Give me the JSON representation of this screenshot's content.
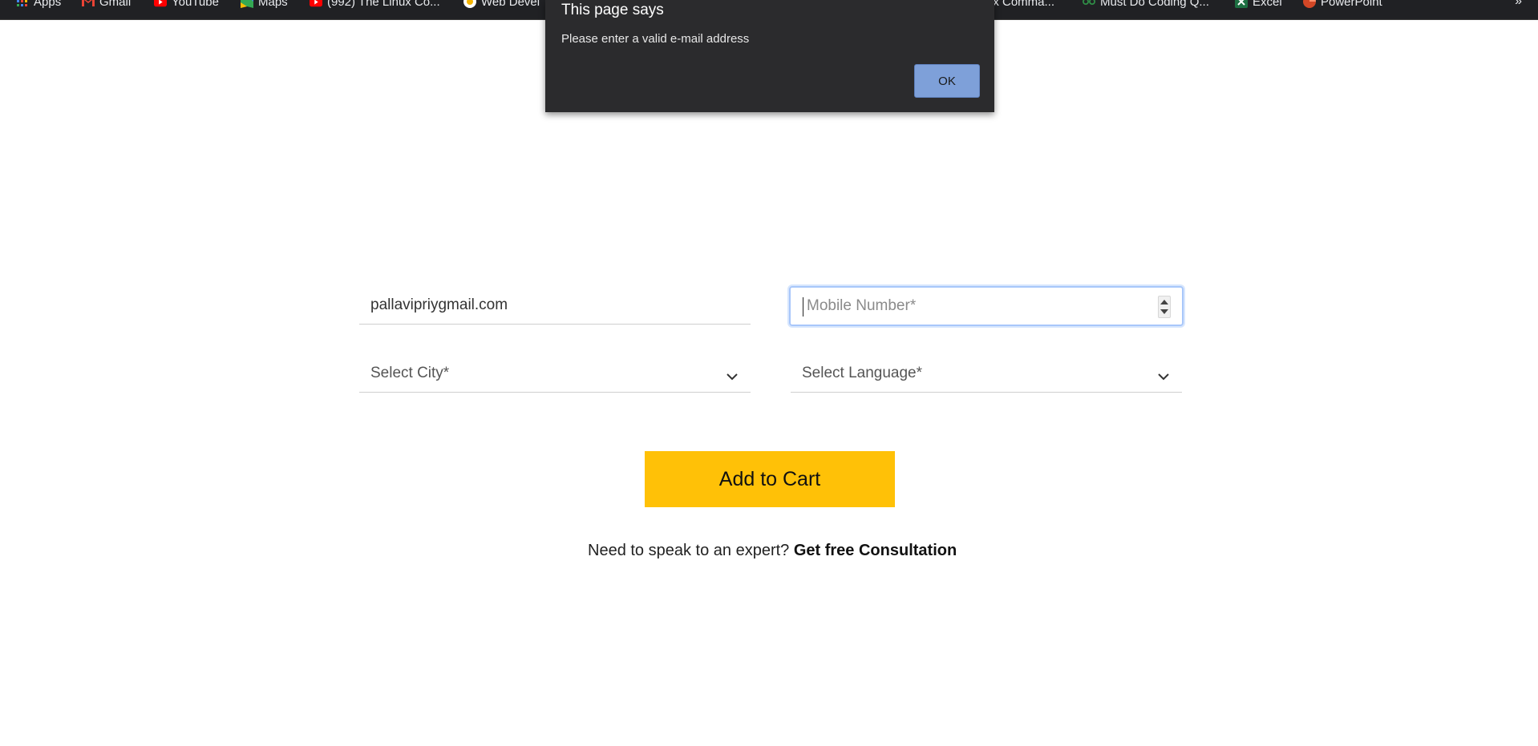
{
  "bookmarks": [
    {
      "label": "Apps",
      "icon": "apps-grid-icon"
    },
    {
      "label": "Gmail",
      "icon": "gmail-icon"
    },
    {
      "label": "YouTube",
      "icon": "youtube-icon"
    },
    {
      "label": "Maps",
      "icon": "maps-icon"
    },
    {
      "label": "(992) The Linux Co...",
      "icon": "youtube-icon"
    },
    {
      "label": "Web Devel",
      "icon": "web-icon"
    },
    {
      "label": "ux Comma...",
      "icon": ""
    },
    {
      "label": "Must Do Coding Q...",
      "icon": "geeks-icon"
    },
    {
      "label": "Excel",
      "icon": "excel-icon"
    },
    {
      "label": "PowerPoint",
      "icon": "powerpoint-icon"
    }
  ],
  "bookmarks_more": "»",
  "form": {
    "email_value": "pallavipriygmail.com",
    "mobile_placeholder": "Mobile Number*",
    "city_placeholder": "Select City*",
    "language_placeholder": "Select Language*",
    "add_to_cart_label": "Add to Cart",
    "consult_text": "Need to speak to an expert?",
    "consult_link": "Get free Consultation"
  },
  "dialog": {
    "title": "This page says",
    "message": "Please enter a valid e-mail address",
    "ok_label": "OK"
  },
  "colors": {
    "button_accent": "#ffc107",
    "dialog_bg": "#2b2b2d",
    "ok_button": "#7ea0d9",
    "focus_ring": "#a8c7fa"
  }
}
